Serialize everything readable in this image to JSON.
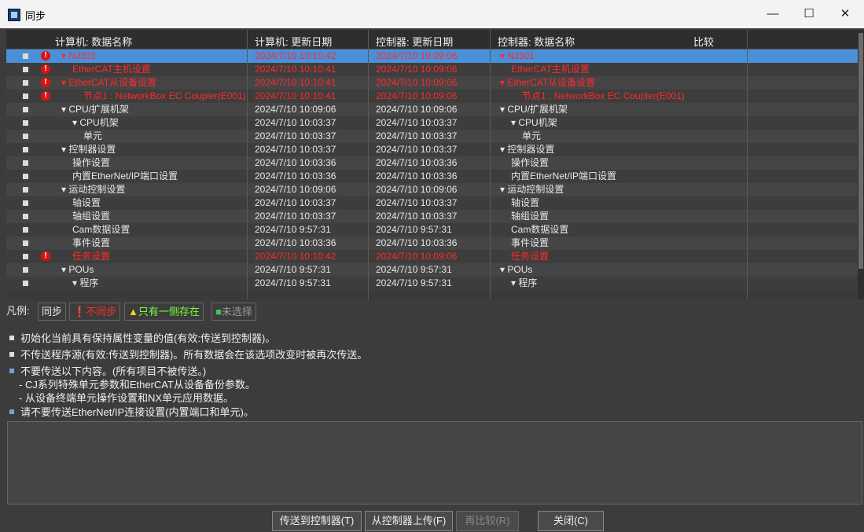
{
  "window": {
    "title": "同步",
    "minimize": "—",
    "maximize": "☐",
    "close": "✕"
  },
  "columns": {
    "pc_name": "计算机: 数据名称",
    "pc_date": "计算机: 更新日期",
    "ctrl_date": "控制器: 更新日期",
    "ctrl_name": "控制器: 数据名称",
    "compare": "比较"
  },
  "rows": [
    {
      "pc_name": "▾ NJ301",
      "pc_date": "2024/7/10 10:10:42",
      "ctrl_date": "2024/7/10 10:09:06",
      "ctrl_name": "▾ NJ301",
      "status": "diff",
      "selected": true
    },
    {
      "pc_name": "EtherCAT主机设置",
      "pc_date": "2024/7/10 10:10:41",
      "ctrl_date": "2024/7/10 10:09:06",
      "ctrl_name": "EtherCAT主机设置",
      "status": "diff"
    },
    {
      "pc_name": "▾ EtherCAT从设备设置",
      "pc_date": "2024/7/10 10:10:41",
      "ctrl_date": "2024/7/10 10:09:06",
      "ctrl_name": "▾ EtherCAT从设备设置",
      "status": "diff"
    },
    {
      "pc_name": "节点1 : NetworkBox EC Coupler(E001)",
      "pc_date": "2024/7/10 10:10:41",
      "ctrl_date": "2024/7/10 10:09:06",
      "ctrl_name": "节点1 : NetworkBox EC Coupler(E001)",
      "status": "diff"
    },
    {
      "pc_name": "▾ CPU/扩展机架",
      "pc_date": "2024/7/10 10:09:06",
      "ctrl_date": "2024/7/10 10:09:06",
      "ctrl_name": "▾ CPU/扩展机架",
      "status": "same"
    },
    {
      "pc_name": "▾ CPU机架",
      "pc_date": "2024/7/10 10:03:37",
      "ctrl_date": "2024/7/10 10:03:37",
      "ctrl_name": "▾ CPU机架",
      "status": "same"
    },
    {
      "pc_name": "单元",
      "pc_date": "2024/7/10 10:03:37",
      "ctrl_date": "2024/7/10 10:03:37",
      "ctrl_name": "单元",
      "status": "same"
    },
    {
      "pc_name": "▾ 控制器设置",
      "pc_date": "2024/7/10 10:03:37",
      "ctrl_date": "2024/7/10 10:03:37",
      "ctrl_name": "▾ 控制器设置",
      "status": "same"
    },
    {
      "pc_name": "操作设置",
      "pc_date": "2024/7/10 10:03:36",
      "ctrl_date": "2024/7/10 10:03:36",
      "ctrl_name": "操作设置",
      "status": "same"
    },
    {
      "pc_name": "内置EtherNet/IP端口设置",
      "pc_date": "2024/7/10 10:03:36",
      "ctrl_date": "2024/7/10 10:03:36",
      "ctrl_name": "内置EtherNet/IP端口设置",
      "status": "same"
    },
    {
      "pc_name": "▾ 运动控制设置",
      "pc_date": "2024/7/10 10:09:06",
      "ctrl_date": "2024/7/10 10:09:06",
      "ctrl_name": "▾ 运动控制设置",
      "status": "same"
    },
    {
      "pc_name": "轴设置",
      "pc_date": "2024/7/10 10:03:37",
      "ctrl_date": "2024/7/10 10:03:37",
      "ctrl_name": "轴设置",
      "status": "same"
    },
    {
      "pc_name": "轴组设置",
      "pc_date": "2024/7/10 10:03:37",
      "ctrl_date": "2024/7/10 10:03:37",
      "ctrl_name": "轴组设置",
      "status": "same"
    },
    {
      "pc_name": "Cam数据设置",
      "pc_date": "2024/7/10 9:57:31",
      "ctrl_date": "2024/7/10 9:57:31",
      "ctrl_name": "Cam数据设置",
      "status": "same"
    },
    {
      "pc_name": "事件设置",
      "pc_date": "2024/7/10 10:03:36",
      "ctrl_date": "2024/7/10 10:03:36",
      "ctrl_name": "事件设置",
      "status": "same"
    },
    {
      "pc_name": "任务设置",
      "pc_date": "2024/7/10 10:10:42",
      "ctrl_date": "2024/7/10 10:09:06",
      "ctrl_name": "任务设置",
      "status": "diff"
    },
    {
      "pc_name": "▾ POUs",
      "pc_date": "2024/7/10 9:57:31",
      "ctrl_date": "2024/7/10 9:57:31",
      "ctrl_name": "▾ POUs",
      "status": "same"
    },
    {
      "pc_name": "▾ 程序",
      "pc_date": "2024/7/10 9:57:31",
      "ctrl_date": "2024/7/10 9:57:31",
      "ctrl_name": "▾ 程序",
      "status": "same"
    }
  ],
  "legend": {
    "label": "凡例:",
    "same": "同步",
    "diff": "不同步",
    "one_side": "只有一侧存在",
    "unselected": "未选择"
  },
  "info": {
    "line1": "初始化当前具有保持属性变量的值(有效:传送到控制器)。",
    "line2": "不传送程序源(有效:传送到控制器)。所有数据会在该选项改变时被再次传送。",
    "line3": "不要传送以下内容。(所有项目不被传送。)",
    "line4": "- CJ系列特殊单元参数和EtherCAT从设备备份参数。",
    "line5": "- 从设备终端单元操作设置和NX单元应用数据。",
    "line6": "请不要传送EtherNet/IP连接设置(内置端口和单元)。"
  },
  "buttons": {
    "transfer_to": "传送到控制器(T)",
    "transfer_from": "从控制器上传(F)",
    "recompare": "再比较(R)",
    "close": "关闭(C)"
  }
}
